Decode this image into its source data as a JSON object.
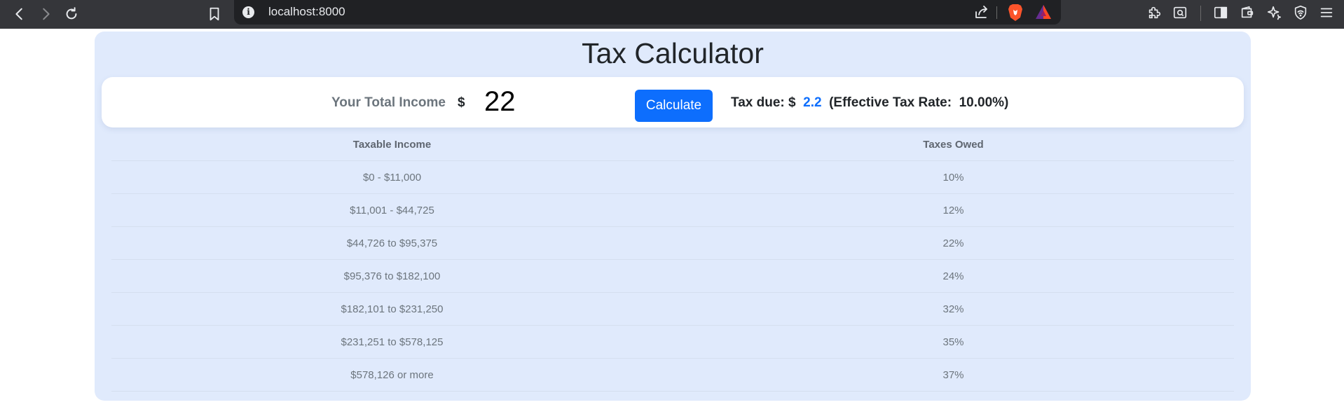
{
  "browser": {
    "url": "localhost:8000"
  },
  "app": {
    "title": "Tax Calculator",
    "income_label": "Your Total Income",
    "currency_symbol": "$",
    "income_value": "22",
    "calculate_label": "Calculate",
    "tax_due_label": "Tax due: $",
    "tax_due_value": "2.2",
    "effective_rate_label": "(Effective Tax Rate:",
    "effective_rate_value": "10.00%)",
    "accent_color": "#0d6efd"
  },
  "table": {
    "headers": [
      "Taxable Income",
      "Taxes Owed"
    ],
    "rows": [
      [
        "$0 - $11,000",
        "10%"
      ],
      [
        "$11,001 - $44,725",
        "12%"
      ],
      [
        "$44,726 to $95,375",
        "22%"
      ],
      [
        "$95,376 to $182,100",
        "24%"
      ],
      [
        "$182,101 to $231,250",
        "32%"
      ],
      [
        "$231,251 to $578,125",
        "35%"
      ],
      [
        "$578,126 or more",
        "37%"
      ]
    ]
  }
}
